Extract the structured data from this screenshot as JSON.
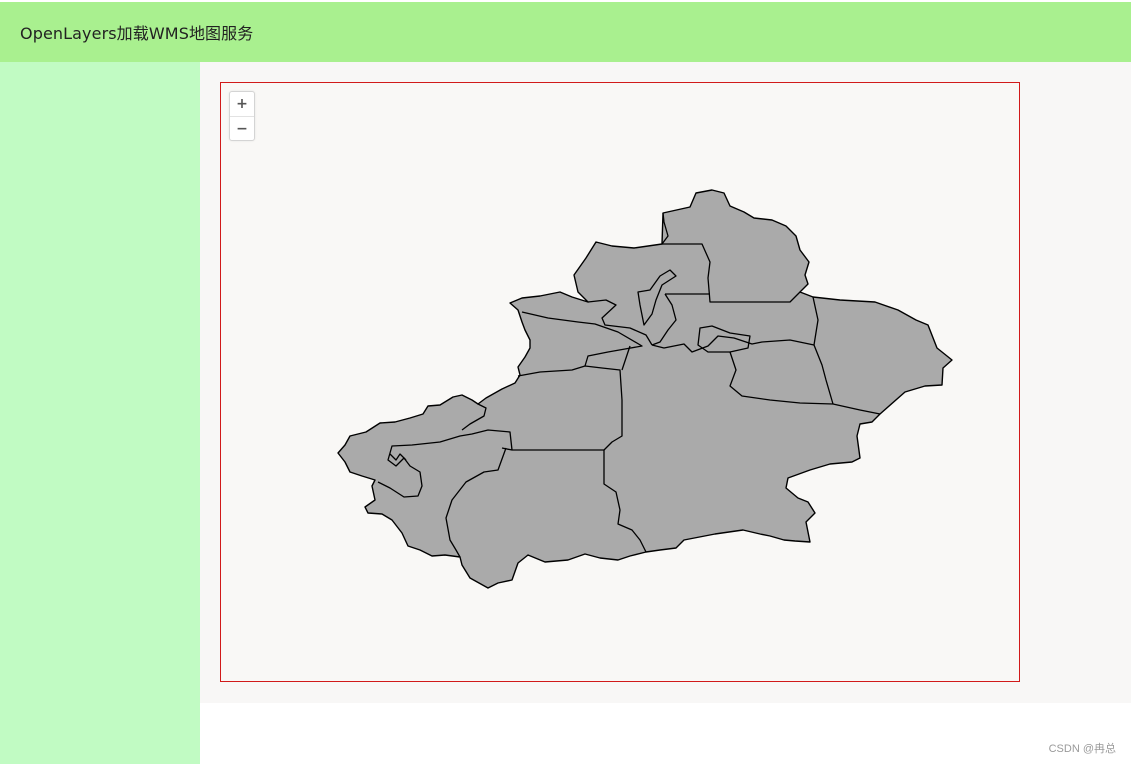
{
  "header": {
    "title": "OpenLayers加载WMS地图服务"
  },
  "map": {
    "zoom_in_label": "+",
    "zoom_out_label": "−",
    "fill_color": "#aaaaaa",
    "stroke_color": "#000000",
    "frame_border_color": "#d11a1a"
  },
  "colors": {
    "header_bg": "#a9f08f",
    "sidebar_bg": "#c1fbc3",
    "main_bg": "#f8f7f6"
  },
  "watermark": {
    "text": "CSDN @冉总"
  }
}
